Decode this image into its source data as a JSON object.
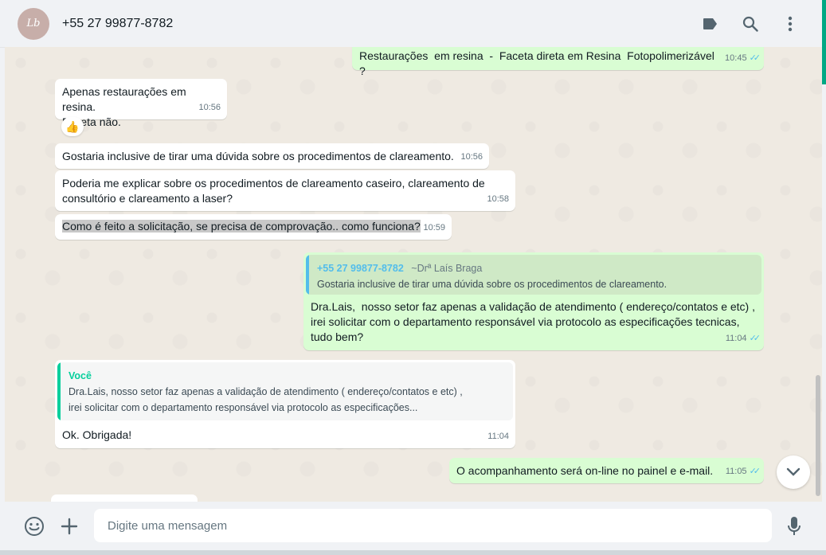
{
  "header": {
    "contact_name": "+55 27 99877-8782",
    "avatar_initials": "Lb",
    "icons": [
      "label-icon",
      "search-icon",
      "menu-icon"
    ]
  },
  "messages": [
    {
      "dir": "out",
      "text": "Restaurações  em resina  -  Faceta direta em Resina  Fotopolimerizável ?",
      "time": "10:45",
      "status": "read"
    },
    {
      "dir": "in",
      "text": "Apenas restaurações em resina.\nFaceta não.",
      "time": "10:56",
      "reaction": "👍"
    },
    {
      "dir": "in",
      "text": "Gostaria inclusive de tirar uma dúvida sobre os procedimentos de clareamento.",
      "time": "10:56"
    },
    {
      "dir": "in",
      "text": "Poderia me explicar sobre os procedimentos de clareamento caseiro, clareamento de consultório e clareamento a laser?",
      "time": "10:58"
    },
    {
      "dir": "in",
      "text": "Como é feito a solicitação, se precisa de comprovação.. como funciona?",
      "time": "10:59",
      "selected": true
    },
    {
      "dir": "out",
      "quote": {
        "author": "+55 27 99877-8782",
        "author_note": "~Drª Laís Braga",
        "text": "Gostaria inclusive de tirar uma dúvida sobre os procedimentos de clareamento."
      },
      "text": "Dra.Lais,  nosso setor faz apenas a validação de atendimento ( endereço/contatos e etc) , irei solicitar com o departamento responsável via protocolo as especificações tecnicas, tudo bem?",
      "time": "11:04",
      "status": "read"
    },
    {
      "dir": "in",
      "quote": {
        "author": "Você",
        "text": "Dra.Lais,  nosso setor faz apenas a validação de atendimento ( endereço/contatos e etc) , irei solicitar com o departamento responsável via protocolo as especificações..."
      },
      "text": "Ok. Obrigada!",
      "time": "11:04"
    },
    {
      "dir": "out",
      "text": "O acompanhamento será on-line no painel e e-mail.",
      "time": "11:05",
      "status": "read"
    }
  ],
  "composer": {
    "placeholder": "Digite uma mensagem",
    "icons": [
      "emoji-icon",
      "attach-icon",
      "microphone-icon"
    ]
  },
  "colors": {
    "accent": "#00a884",
    "incoming_bubble": "#ffffff",
    "outgoing_bubble": "#d9fdd3",
    "read_ticks": "#53bdeb",
    "quote_author_in": "#53bdeb",
    "quote_author_out": "#06cf9c"
  }
}
